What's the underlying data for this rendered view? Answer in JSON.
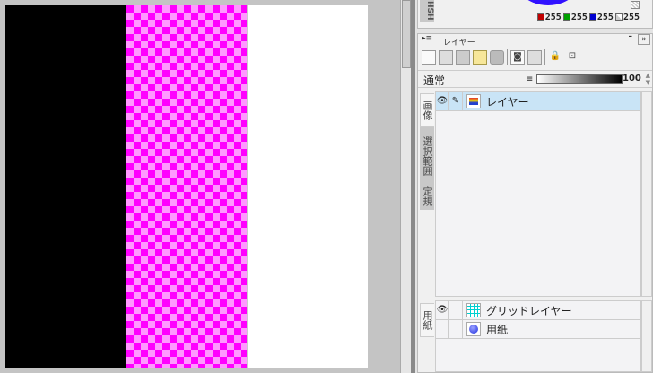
{
  "color_panel": {
    "tab_label": "HSH",
    "red": "255",
    "green": "255",
    "blue": "255",
    "alpha": "255",
    "colors": {
      "red": "#c00000",
      "green": "#00a000",
      "blue": "#0000d0"
    }
  },
  "layer_panel": {
    "title": "レイヤー",
    "menu_icon": "▸≡",
    "minimize": "–",
    "expand": "»",
    "blend_mode": "通常",
    "opacity": "100",
    "side_tabs": {
      "image": "画像",
      "selection": "選択範囲",
      "ruler": "定規",
      "paper": "用紙"
    },
    "layers": [
      {
        "name": "レイヤー",
        "visible": true,
        "selected": true
      }
    ],
    "paper_layers": [
      {
        "name": "グリッドレイヤー",
        "visible": true
      },
      {
        "name": "用紙",
        "visible": false
      }
    ]
  }
}
